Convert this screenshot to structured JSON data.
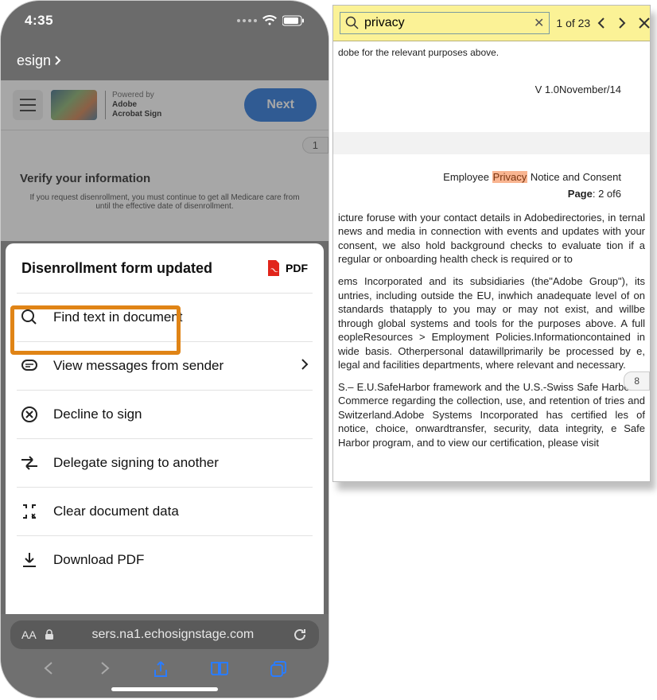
{
  "status": {
    "time": "4:35"
  },
  "crumb": {
    "label": "esign"
  },
  "app_bar": {
    "powered_by": "Powered by",
    "brand_line1": "Adobe",
    "brand_line2": "Acrobat Sign",
    "next": "Next"
  },
  "doc_preview": {
    "page_num": "1",
    "verify_heading": "Verify your information",
    "verify_line1": "If you request disenrollment, you must continue to get all Medicare care from",
    "verify_line2": "until the effective date of disenrollment."
  },
  "sheet": {
    "title": "Disenrollment form updated",
    "pdf_label": "PDF",
    "items": [
      {
        "label": "Find text in document",
        "icon": "search"
      },
      {
        "label": "View messages from sender",
        "icon": "message",
        "chevron": true
      },
      {
        "label": "Decline to sign",
        "icon": "decline"
      },
      {
        "label": "Delegate signing to another",
        "icon": "delegate"
      },
      {
        "label": "Clear document data",
        "icon": "clear"
      },
      {
        "label": "Download PDF",
        "icon": "download"
      }
    ]
  },
  "browser": {
    "text_size": "AA",
    "url": "sers.na1.echosignstage.com"
  },
  "find": {
    "query": "privacy",
    "count": "1 of 23"
  },
  "doc": {
    "top_line": "dobe for the relevant purposes above.",
    "version": "V 1.0November/14",
    "notice_pre": "Employee ",
    "notice_hl": "Privacy",
    "notice_post": " Notice and Consent",
    "page_label": "Page",
    "page_val": ": 2 of6",
    "para1": "icture foruse with your contact details in Adobedirectories, in ternal news and media in connection with events and updates with your consent, we also hold background checks to evaluate tion if a regular or onboarding health check is required or to",
    "para2": "ems Incorporated and its subsidiaries (the\"Adobe Group\"), its untries, including outside the EU, inwhich anadequate level of on standards thatapply to you may or may not exist, and willbe through global systems and tools for the purposes above. A full eopleResources > Employment Policies.Informationcontained in wide basis. Otherpersonal datawillprimarily be processed by e, legal and facilities departments, where relevant and necessary.",
    "para3": "S.– E.U.SafeHarbor framework and the U.S.-Swiss Safe Harbor of Commerce regarding the collection, use, and retention of tries and Switzerland.Adobe Systems Incorporated has certified les of notice, choice, onwardtransfer, security, data integrity, e Safe Harbor program, and to view our certification, please visit",
    "page_badge": "8"
  }
}
